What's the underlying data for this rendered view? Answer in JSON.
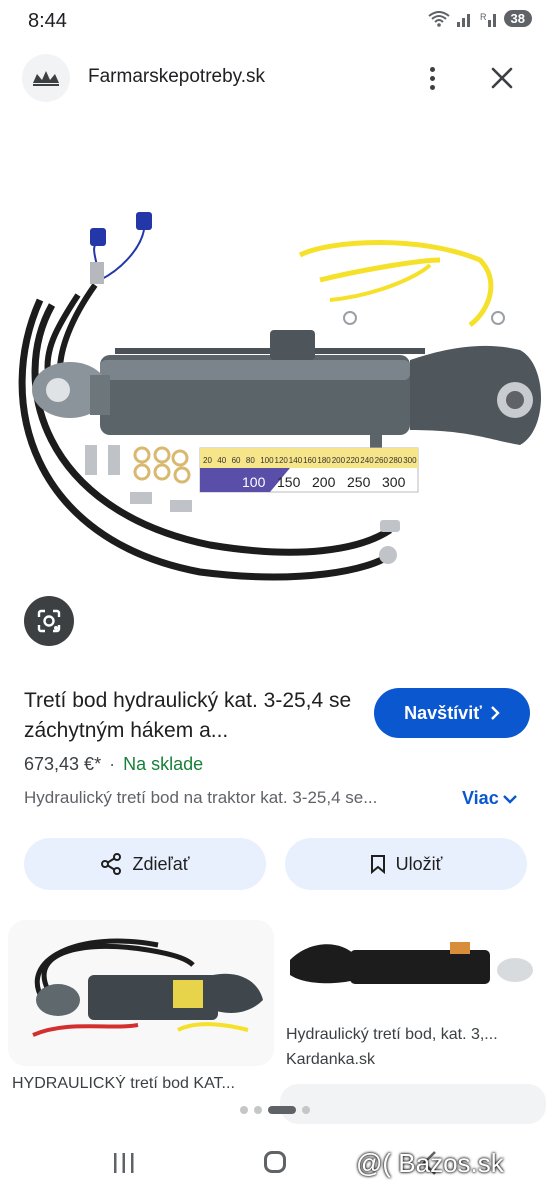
{
  "status_bar": {
    "time": "8:44",
    "battery": "38"
  },
  "header": {
    "site_name": "Farmarskepotreby.sk",
    "logo_icon": "crown-logo-icon",
    "menu_icon": "more-vert-icon",
    "close_icon": "close-icon"
  },
  "product": {
    "title": "Tretí bod hydraulický kat. 3-25,4 se záchytným hákem a...",
    "visit_label": "Navštíviť",
    "price": "673,43 €*",
    "separator": "·",
    "stock": "Na sklade",
    "description": "Hydraulický tretí bod na traktor kat. 3-25,4 se...",
    "more_label": "Viac",
    "share_label": "Zdieľať",
    "save_label": "Uložiť"
  },
  "related": [
    {
      "caption": "HYDRAULICKÝ tretí bod KAT..."
    },
    {
      "caption": "Hydraulický tretí bod, kat. 3,...",
      "source": "Kardanka.sk"
    }
  ],
  "main_image": {
    "scale_top": [
      "20",
      "40",
      "60",
      "80",
      "100",
      "120",
      "140",
      "160",
      "180",
      "200",
      "220",
      "240",
      "260",
      "280",
      "300"
    ],
    "scale_bottom": [
      "100",
      "150",
      "200",
      "250",
      "300"
    ]
  },
  "watermark": "@( Bazos.sk",
  "colors": {
    "accent": "#0b57d0",
    "stock_green": "#188038",
    "chip_bg": "#e8f0fe",
    "cylinder": "#5b6469",
    "hose_yellow": "#f5e12a"
  }
}
